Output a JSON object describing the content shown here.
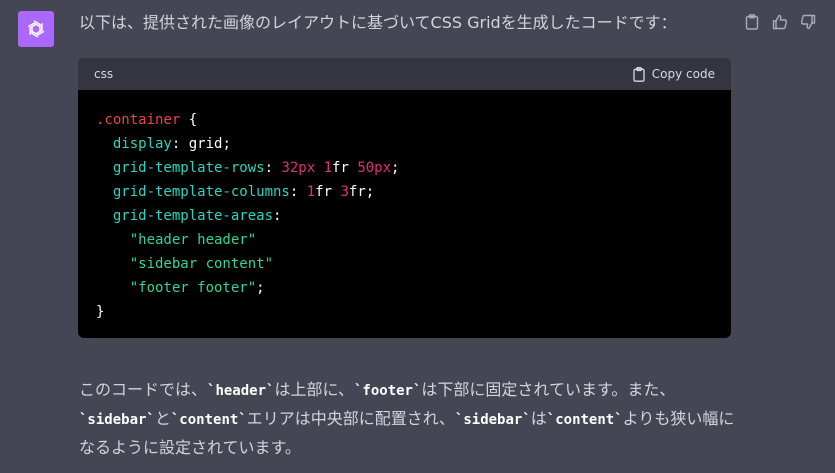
{
  "assistant": {
    "avatar_icon": "openai-logo-icon",
    "avatar_color": "#ab68ff"
  },
  "actions": {
    "copy_icon": "clipboard-icon",
    "like_icon": "thumbs-up-icon",
    "dislike_icon": "thumbs-down-icon"
  },
  "message": {
    "intro": "以下は、提供された画像のレイアウトに基づいてCSS Gridを生成したコードです：",
    "code_block": {
      "language": "css",
      "copy_label": "Copy code",
      "lines": {
        "l1_sel": ".container",
        "l1_brace": " {",
        "l2_prop": "display",
        "l2_rest": ": grid;",
        "l3_prop": "grid-template-rows",
        "l3_colon": ": ",
        "l3_v1": "32px",
        "l3_sp1": " ",
        "l3_v2n": "1",
        "l3_v2u": "fr",
        "l3_sp2": " ",
        "l3_v3": "50px",
        "l3_end": ";",
        "l4_prop": "grid-template-columns",
        "l4_colon": ": ",
        "l4_v1n": "1",
        "l4_v1u": "fr",
        "l4_sp": " ",
        "l4_v2n": "3",
        "l4_v2u": "fr",
        "l4_end": ";",
        "l5_prop": "grid-template-areas",
        "l5_colon": ":",
        "l6_str": "\"header header\"",
        "l7_str": "\"sidebar content\"",
        "l8_str": "\"footer footer\"",
        "l8_end": ";",
        "l9": "}"
      }
    },
    "outro": {
      "p1": "このコードでは、",
      "c1": "`header`",
      "p2": "は上部に、",
      "c2": "`footer`",
      "p3": "は下部に固定されています。また、",
      "c3": "`sidebar`",
      "p4": "と",
      "c4": "`content`",
      "p5": "エリアは中央部に配置され、",
      "c5": "`sidebar`",
      "p6": "は",
      "c6": "`content`",
      "p7": "よりも狭い幅になるように設定されています。"
    }
  }
}
